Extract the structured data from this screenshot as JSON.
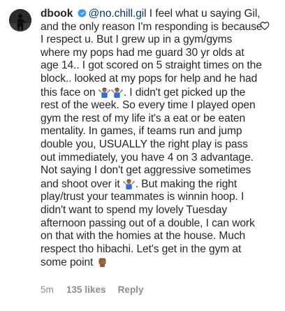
{
  "comment": {
    "username": "dbook",
    "mention": "@no.chill.gil",
    "segments": {
      "s1": " I feel what u saying Gil, and the only reason I'm responding is because I respect u. But I grew up in a gym/gyms where my pops had me guard 30 yr olds at age 14.. I got scored on 5 straight times on the block.. looked at my pops for help and he had this face on ",
      "s2": ". I didn't get picked up the rest of the week. So every time I played open gym the rest of my life it's a eat or be eaten mentality. In games, if teams run and jump double you, USUALLY the right play is pass out immediately, you have 4 on 3 advantage. Not saying I don't get aggressive sometimes and shoot over it ",
      "s3": ". But making the right play/trust your teammates is winnin hoop. I didn't want to spend my lovely Tuesday afternoon passing out of a double, I can work on that with the homies at the house. Much respect tho hibachi. Let's get in the gym at some point "
    },
    "emojis": {
      "e1": "person-shrugging-emoji",
      "e2": "person-shrugging-emoji",
      "e3": "person-shrugging-emoji",
      "e4": "raised-fist-emoji"
    },
    "time": "5m",
    "likes": "135 likes",
    "reply_label": "Reply"
  },
  "colors": {
    "text": "#262626",
    "mention": "#00376b",
    "meta": "#8e8e8e",
    "verified": "#3897f0"
  },
  "icons": {
    "verified": "verified-badge-icon",
    "like": "heart-icon"
  }
}
